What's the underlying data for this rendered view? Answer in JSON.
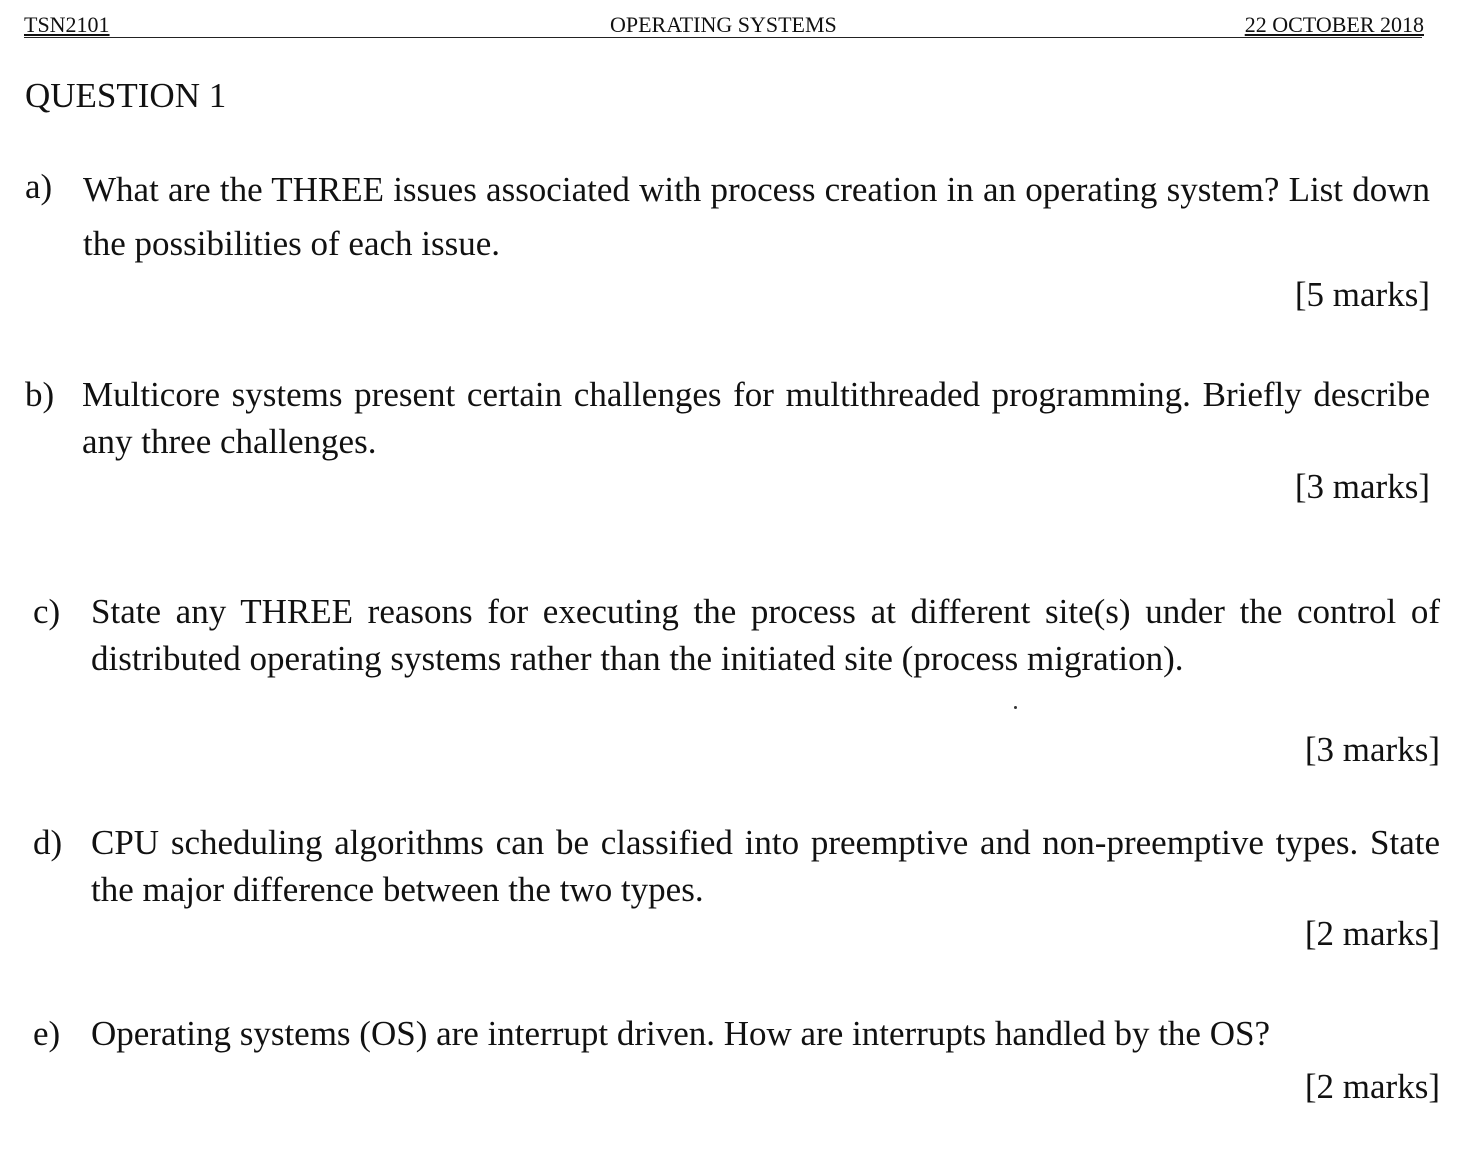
{
  "header": {
    "course_code": "TSN2101",
    "course_title": "OPERATING SYSTEMS",
    "date": "22 OCTOBER 2018"
  },
  "question": {
    "title": "QUESTION 1",
    "parts": [
      {
        "label": "a)",
        "text": "What are the THREE issues associated with process creation in an operating system? List down the possibilities of each issue.",
        "marks": "[5 marks]"
      },
      {
        "label": "b)",
        "text": "Multicore systems present certain challenges for multithreaded programming. Briefly describe any three challenges.",
        "marks": "[3 marks]"
      },
      {
        "label": "c)",
        "text": "State any THREE reasons for executing the process at different site(s) under the control of distributed operating systems rather than the initiated site (process migration).",
        "marks": "[3 marks]"
      },
      {
        "label": "d)",
        "text": "CPU scheduling algorithms can be classified into preemptive and non-preemptive types. State the major difference between the two types.",
        "marks": "[2 marks]"
      },
      {
        "label": "e)",
        "text": "Operating systems (OS) are interrupt driven. How are interrupts handled by the OS?",
        "marks": "[2 marks]"
      }
    ]
  }
}
